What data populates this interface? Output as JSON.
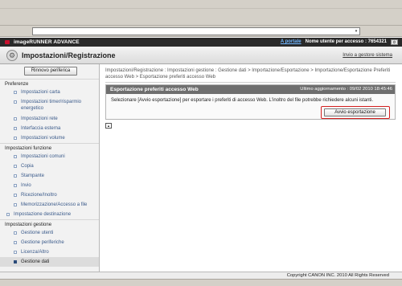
{
  "brand": {
    "name": "imageRUNNER ADVANCE",
    "portal_link": "A portale",
    "user_label": "Nome utente per accesso : 7654321",
    "logout_icon": "logout-icon"
  },
  "title_bar": {
    "title": "Impostazioni/Registrazione",
    "link": "Invio a gestore sistema",
    "icon": "settings-icon"
  },
  "sidebar": {
    "refresh_button": "Rinnovo periferica",
    "sections": [
      {
        "label": "Preferenze",
        "items": [
          {
            "label": "Impostazioni carta"
          },
          {
            "label": "Impostazioni timer/risparmio energetico"
          },
          {
            "label": "Impostazioni rete"
          },
          {
            "label": "Interfaccia esterna"
          },
          {
            "label": "Impostazioni volume"
          }
        ]
      },
      {
        "label": "Impostazioni funzione",
        "items": [
          {
            "label": "Impostazioni comuni"
          },
          {
            "label": "Copia"
          },
          {
            "label": "Stampante"
          },
          {
            "label": "Invio"
          },
          {
            "label": "Ricezione/Inoltro"
          },
          {
            "label": "Memorizzazione/Accesso a file"
          }
        ]
      }
    ],
    "destination_item": "Impostazione destinazione",
    "management": {
      "label": "Impostazioni gestione",
      "items": [
        {
          "label": "Gestione utenti"
        },
        {
          "label": "Gestione periferiche"
        },
        {
          "label": "Licenza/Altro"
        },
        {
          "label": "Gestione dati"
        }
      ]
    }
  },
  "content": {
    "breadcrumb": "Impostazioni/Registrazione : Impostazioni gestione : Gestione dati > Importazione/Esportazione > Importazione/Esportazione Preferiti accesso Web > Esportazione preferiti accesso Web",
    "panel": {
      "title": "Esportazione preferiti accesso Web",
      "updated": "Ultimo aggiornamento : 09/02 2010 18:45:46",
      "message": "Selezionare [Avvio esportazione] per esportare i preferiti di accesso Web. L'inoltro del file potrebbe richiedere alcuni istanti.",
      "export_button": "Avvio esportazione"
    },
    "to_top_icon": "arrow-up-icon"
  },
  "footer": {
    "copyright": "Copyright CANON INC. 2010 All Rights Reserved"
  },
  "colors": {
    "brand_bar": "#2a2a2a",
    "panel_header": "#6e6e6e",
    "highlight": "#d21e1e",
    "link": "#3a5a8a"
  }
}
